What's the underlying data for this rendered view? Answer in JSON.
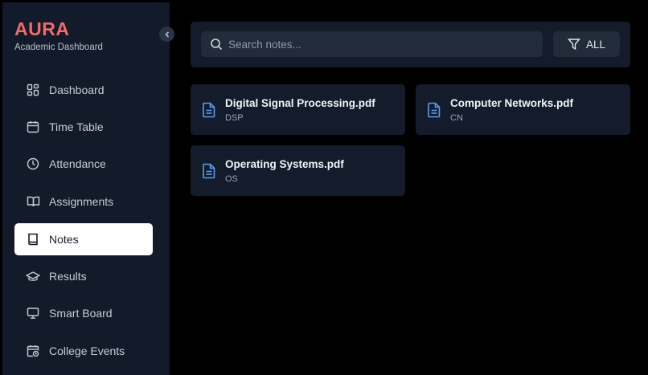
{
  "brand": {
    "title": "AURA",
    "subtitle": "Academic Dashboard"
  },
  "sidebar": {
    "items": [
      {
        "label": "Dashboard",
        "icon": "dashboard-grid-icon",
        "active": false
      },
      {
        "label": "Time Table",
        "icon": "calendar-icon",
        "active": false
      },
      {
        "label": "Attendance",
        "icon": "clock-icon",
        "active": false
      },
      {
        "label": "Assignments",
        "icon": "open-book-icon",
        "active": false
      },
      {
        "label": "Notes",
        "icon": "notebook-icon",
        "active": true
      },
      {
        "label": "Results",
        "icon": "graduation-cap-icon",
        "active": false
      },
      {
        "label": "Smart Board",
        "icon": "monitor-icon",
        "active": false
      },
      {
        "label": "College Events",
        "icon": "calendar-clock-icon",
        "active": false
      }
    ]
  },
  "search": {
    "placeholder": "Search notes...",
    "value": ""
  },
  "filter": {
    "label": "ALL"
  },
  "notes": [
    {
      "title": "Digital Signal Processing.pdf",
      "code": "DSP"
    },
    {
      "title": "Computer Networks.pdf",
      "code": "CN"
    },
    {
      "title": "Operating Systems.pdf",
      "code": "OS"
    }
  ],
  "colors": {
    "accent": "#f06b6b",
    "sidebar_bg": "#131b2a",
    "card_bg": "#141c2b",
    "file_icon": "#5b9cf0",
    "page_bg": "#000000"
  }
}
